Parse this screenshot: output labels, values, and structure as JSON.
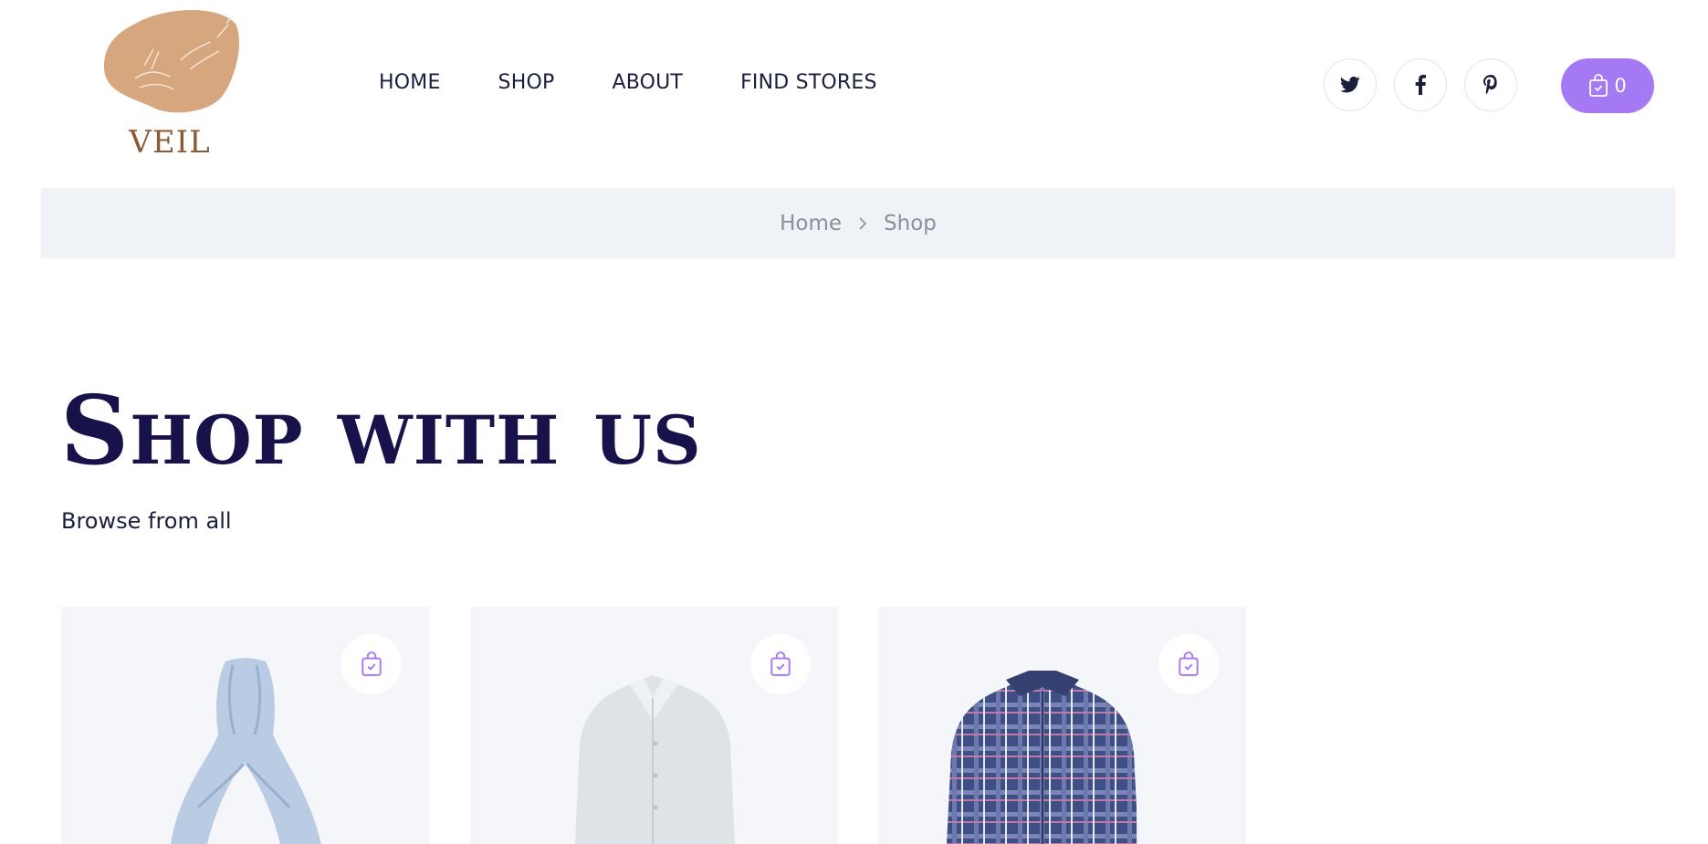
{
  "brand": {
    "name": "VEIL"
  },
  "nav": {
    "items": [
      {
        "label": "HOME"
      },
      {
        "label": "SHOP"
      },
      {
        "label": "ABOUT"
      },
      {
        "label": "FIND STORES"
      }
    ]
  },
  "social": [
    {
      "icon": "twitter-icon"
    },
    {
      "icon": "facebook-icon"
    },
    {
      "icon": "pinterest-icon"
    }
  ],
  "cart": {
    "count": "0",
    "icon": "shopping-bag-icon"
  },
  "breadcrumb": {
    "items": [
      "Home",
      "Shop"
    ],
    "separator_icon": "chevron-right-icon"
  },
  "hero": {
    "title": "Shop with us",
    "subtitle": "Browse from all"
  },
  "products": [
    {
      "image": "light blue scarf",
      "action_icon": "shopping-bag-check-icon"
    },
    {
      "image": "light grey dress shirt",
      "action_icon": "shopping-bag-check-icon"
    },
    {
      "image": "blue plaid shirt",
      "action_icon": "shopping-bag-check-icon"
    }
  ],
  "colors": {
    "accent": "#a479f3",
    "title": "#17124a",
    "breadcrumb_bg": "#eff3f7",
    "card_bg": "#f5f6fa",
    "logo_blob": "#d6a77f",
    "logo_text": "#8b5a34"
  }
}
